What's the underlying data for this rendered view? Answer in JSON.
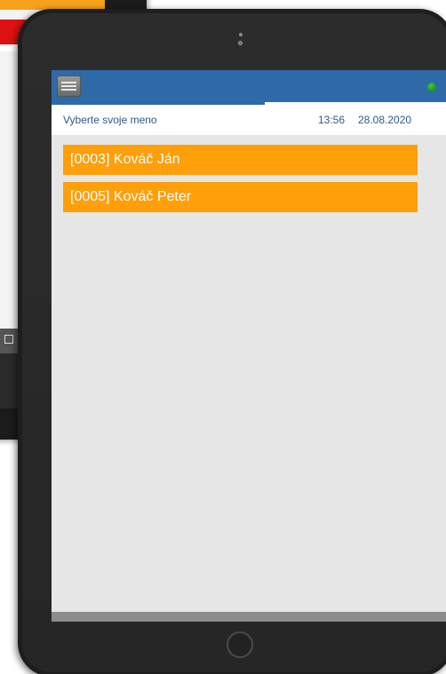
{
  "app": {
    "status_color": "#1aa81a",
    "accent_color": "#2e6aa8",
    "item_color": "#ff9f0a"
  },
  "header": {
    "menu_icon": "hamburger-menu-icon",
    "status_icon": "connection-status-dot",
    "progress": 0.54
  },
  "subheader": {
    "prompt": "Vyberte svoje meno",
    "time": "13:56",
    "date": "28.08.2020"
  },
  "users": [
    {
      "label": "[0003] Kováč Ján"
    },
    {
      "label": "[0005] Kováč Peter"
    }
  ]
}
